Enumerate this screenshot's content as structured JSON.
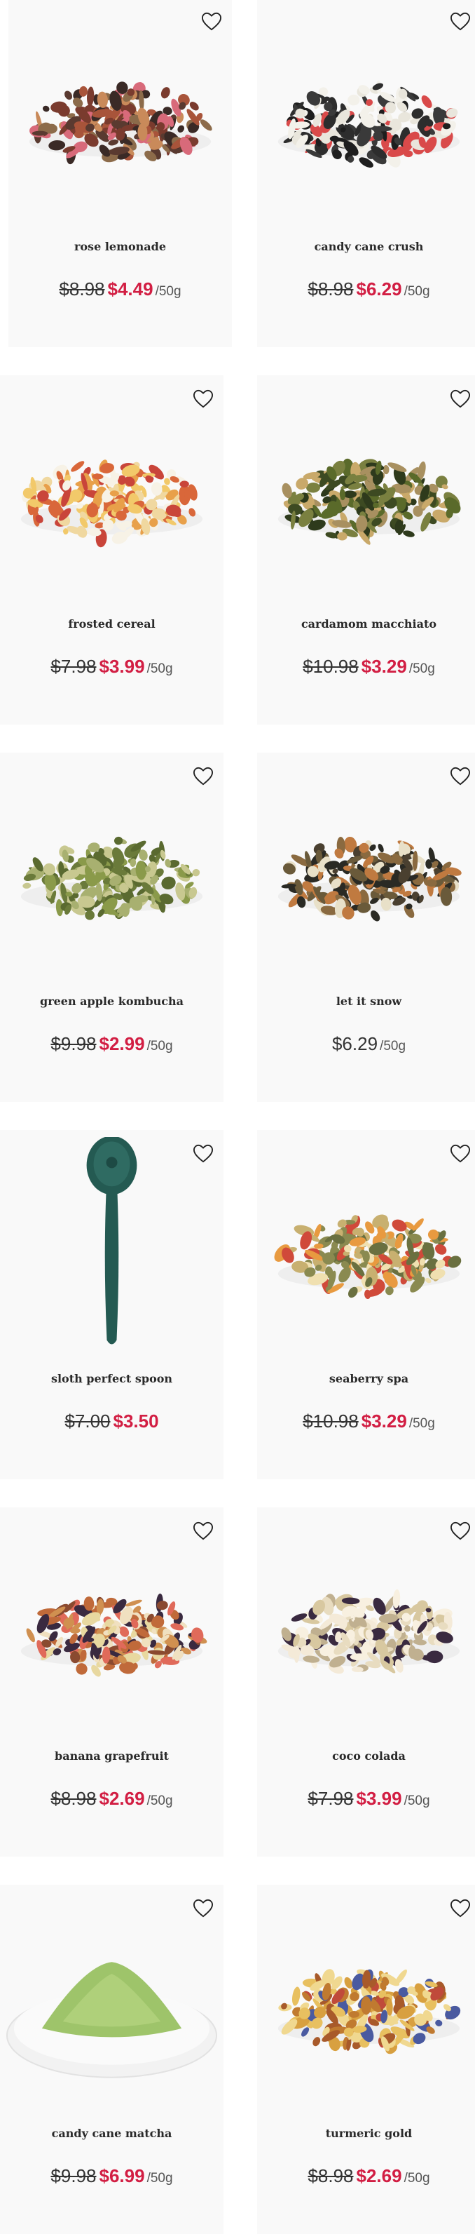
{
  "products": [
    {
      "name": "rose lemonade",
      "old_price": "$8.98",
      "price": "$4.49",
      "unit": "/50g",
      "kind": "rose"
    },
    {
      "name": "candy cane crush",
      "old_price": "$8.98",
      "price": "$6.29",
      "unit": "/50g",
      "kind": "candy"
    },
    {
      "name": "frosted cereal",
      "old_price": "$7.98",
      "price": "$3.99",
      "unit": "/50g",
      "kind": "cereal"
    },
    {
      "name": "cardamom macchiato",
      "old_price": "$10.98",
      "price": "$3.29",
      "unit": "/50g",
      "kind": "green"
    },
    {
      "name": "green apple kombucha",
      "old_price": "$9.98",
      "price": "$2.99",
      "unit": "/50g",
      "kind": "lightgreen"
    },
    {
      "name": "let it snow",
      "old_price": "",
      "price": "$6.29",
      "unit": "/50g",
      "kind": "snow"
    },
    {
      "name": "sloth perfect spoon",
      "old_price": "$7.00",
      "price": "$3.50",
      "unit": "",
      "kind": "spoon"
    },
    {
      "name": "seaberry spa",
      "old_price": "$10.98",
      "price": "$3.29",
      "unit": "/50g",
      "kind": "seaberry"
    },
    {
      "name": "banana grapefruit",
      "old_price": "$8.98",
      "price": "$2.69",
      "unit": "/50g",
      "kind": "banana"
    },
    {
      "name": "coco colada",
      "old_price": "$7.98",
      "price": "$3.99",
      "unit": "/50g",
      "kind": "coco"
    },
    {
      "name": "candy cane matcha",
      "old_price": "$9.98",
      "price": "$6.99",
      "unit": "/50g",
      "kind": "matcha"
    },
    {
      "name": "turmeric gold",
      "old_price": "$8.98",
      "price": "$2.69",
      "unit": "/50g",
      "kind": "turmeric"
    }
  ],
  "colors": {
    "sale": "#d21e43",
    "text": "#2b2b2b",
    "card_bg": "#f9f9f9",
    "spoon": "#245a52"
  },
  "icons": {
    "wishlist": "heart-outline-icon"
  }
}
